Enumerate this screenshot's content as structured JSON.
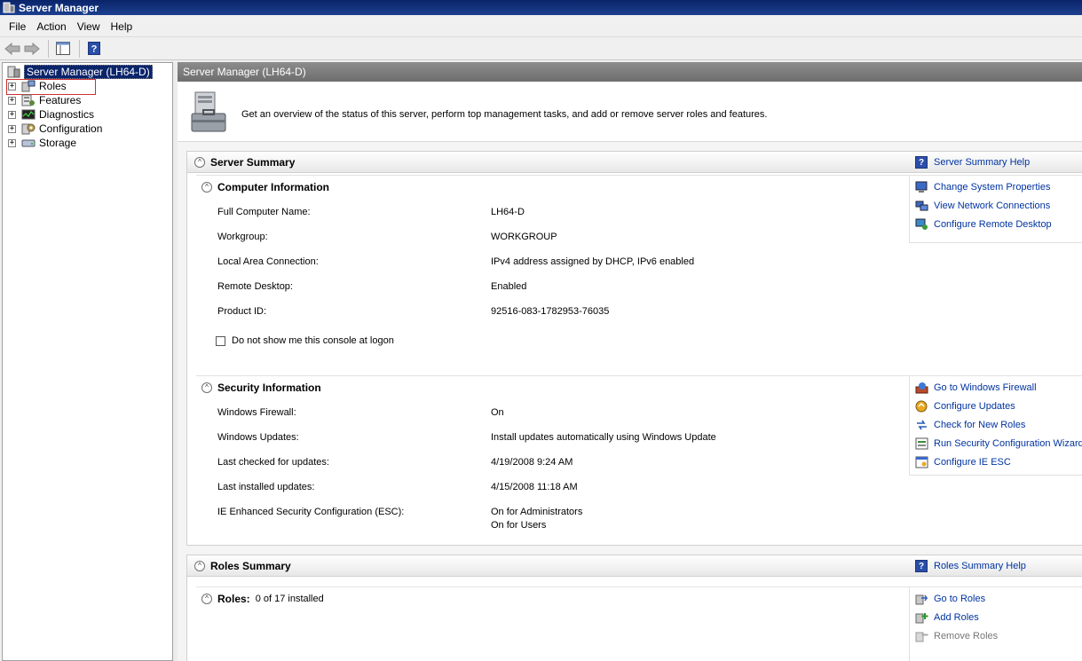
{
  "window": {
    "title": "Server Manager"
  },
  "menu": {
    "file": "File",
    "action": "Action",
    "view": "View",
    "help": "Help"
  },
  "tree": {
    "root": "Server Manager (LH64-D)",
    "items": [
      "Roles",
      "Features",
      "Diagnostics",
      "Configuration",
      "Storage"
    ]
  },
  "main": {
    "header": "Server Manager (LH64-D)",
    "intro": "Get an overview of the status of this server, perform top management tasks, and add or remove server roles and features."
  },
  "server_summary": {
    "title": "Server Summary",
    "help": "Server Summary Help",
    "computer_info": {
      "title": "Computer Information",
      "rows": [
        {
          "label": "Full Computer Name:",
          "value": "LH64-D"
        },
        {
          "label": "Workgroup:",
          "value": "WORKGROUP"
        },
        {
          "label": "Local Area Connection:",
          "value": "IPv4 address assigned by DHCP, IPv6 enabled"
        },
        {
          "label": "Remote Desktop:",
          "value": "Enabled"
        },
        {
          "label": "Product ID:",
          "value": "92516-083-1782953-76035"
        }
      ],
      "checkbox": "Do not show me this console at logon",
      "tasks": [
        "Change System Properties",
        "View Network Connections",
        "Configure Remote Desktop"
      ]
    },
    "security_info": {
      "title": "Security Information",
      "rows": [
        {
          "label": "Windows Firewall:",
          "value": "On"
        },
        {
          "label": "Windows Updates:",
          "value": "Install updates automatically using Windows Update"
        },
        {
          "label": "Last checked for updates:",
          "value": "4/19/2008 9:24 AM"
        },
        {
          "label": "Last installed updates:",
          "value": "4/15/2008 11:18 AM"
        },
        {
          "label": "IE Enhanced Security Configuration (ESC):",
          "value": "On for Administrators",
          "value2": "On for Users"
        }
      ],
      "tasks": [
        "Go to Windows Firewall",
        "Configure Updates",
        "Check for New Roles",
        "Run Security Configuration Wizard",
        "Configure IE ESC"
      ]
    }
  },
  "roles_summary": {
    "title": "Roles Summary",
    "help": "Roles Summary Help",
    "roles_label": "Roles:",
    "roles_value": "0 of 17 installed",
    "tasks": [
      "Go to Roles",
      "Add Roles",
      "Remove Roles"
    ]
  }
}
